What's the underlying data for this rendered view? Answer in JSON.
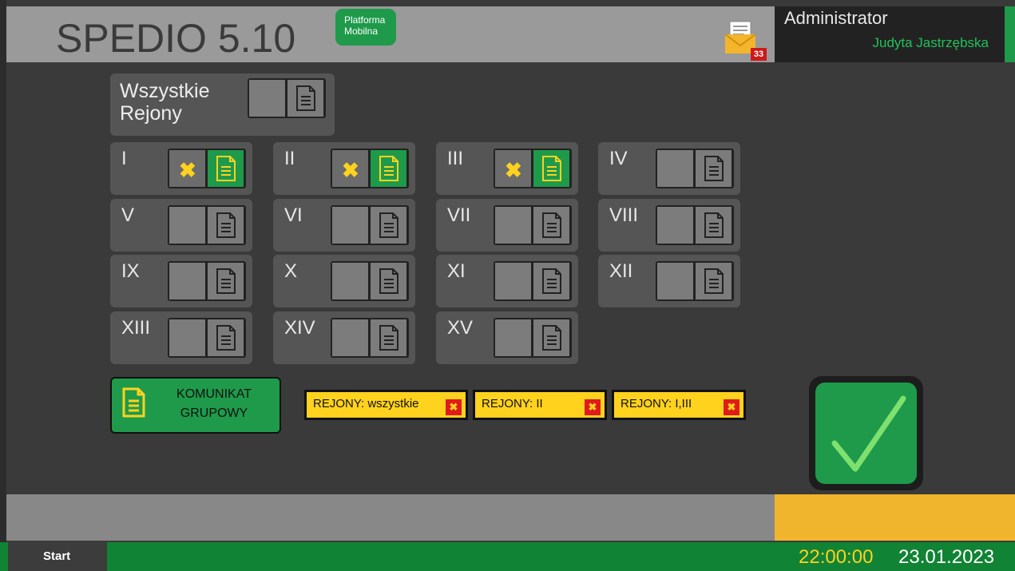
{
  "header": {
    "title": "SPEDIO 5.10",
    "platform_badge": [
      "Platforma",
      "Mobilna"
    ],
    "mail_icon": "envelope-icon",
    "unread_count": "33",
    "user_role": "Administrator",
    "user_name": "Judyta Jastrzębska"
  },
  "all_regions": {
    "label_line1": "Wszystkie",
    "label_line2": "Rejony",
    "checked": false
  },
  "regions": [
    {
      "label": "I",
      "checked": true
    },
    {
      "label": "II",
      "checked": true
    },
    {
      "label": "III",
      "checked": true
    },
    {
      "label": "IV",
      "checked": false
    },
    {
      "label": "V",
      "checked": false
    },
    {
      "label": "VI",
      "checked": false
    },
    {
      "label": "VII",
      "checked": false
    },
    {
      "label": "VIII",
      "checked": false
    },
    {
      "label": "IX",
      "checked": false
    },
    {
      "label": "X",
      "checked": false
    },
    {
      "label": "XI",
      "checked": false
    },
    {
      "label": "XII",
      "checked": false
    },
    {
      "label": "XIII",
      "checked": false
    },
    {
      "label": "XIV",
      "checked": false
    },
    {
      "label": "XV",
      "checked": false
    }
  ],
  "group_message": {
    "line1": "KOMUNIKAT",
    "line2": "GRUPOWY",
    "icon": "document-icon"
  },
  "filters": [
    {
      "label": "REJONY: wszystkie"
    },
    {
      "label": "REJONY: II"
    },
    {
      "label": "REJONY: I,III"
    }
  ],
  "confirm": {
    "icon": "checkmark-icon"
  },
  "taskbar": {
    "start_label": "Start",
    "time": "22:00:00",
    "date": "23.01.2023"
  },
  "colors": {
    "accent_green": "#1e9a4a",
    "accent_yellow": "#ffd21e",
    "badge_red": "#e01b1b",
    "orange": "#f0b52c"
  }
}
